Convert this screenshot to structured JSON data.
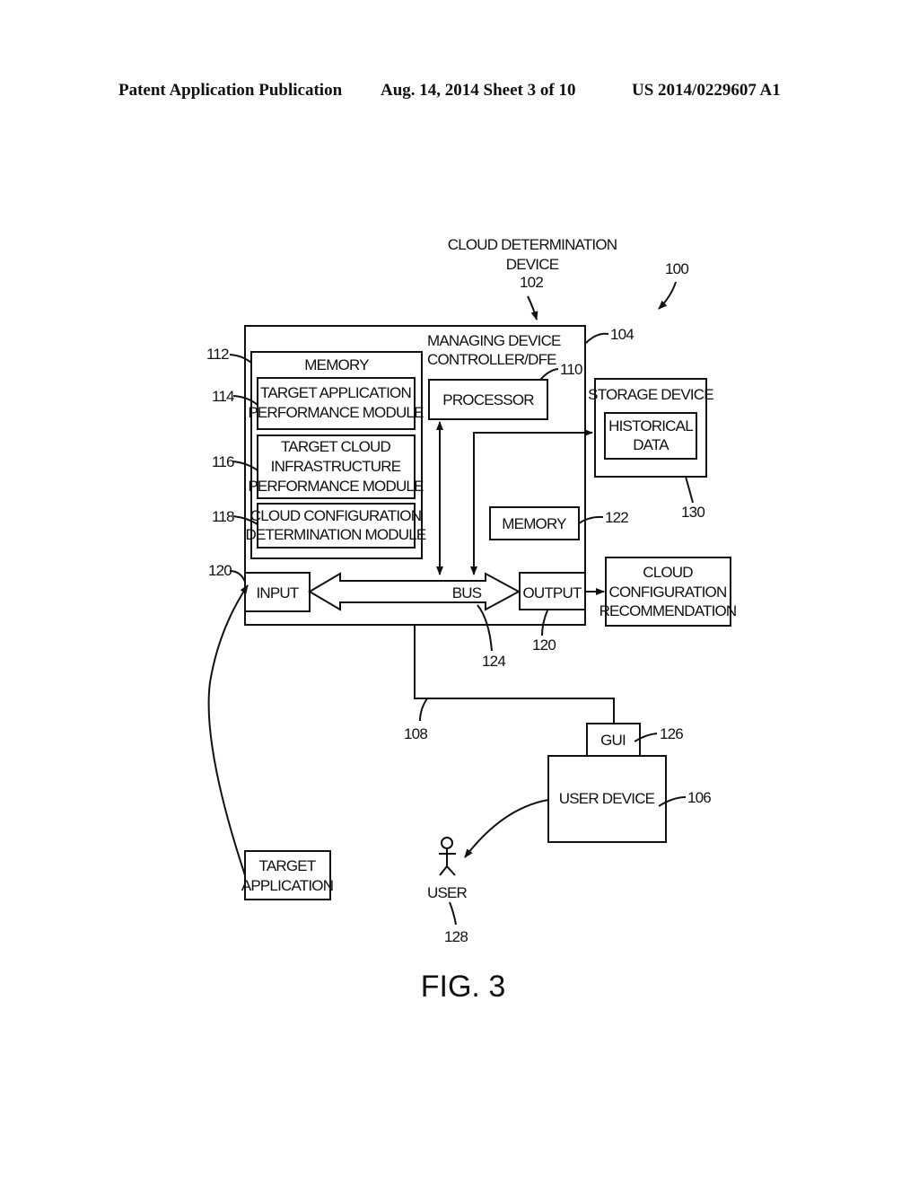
{
  "header": {
    "publication": "Patent Application Publication",
    "date_sheet": "Aug. 14, 2014  Sheet 3 of 10",
    "number": "US 2014/0229607 A1"
  },
  "diagram": {
    "title_line1": "CLOUD DETERMINATION",
    "title_line2": "DEVICE",
    "ref_102": "102",
    "ref_100": "100",
    "ref_104": "104",
    "managing_line1": "MANAGING DEVICE",
    "managing_line2": "CONTROLLER/DFE",
    "memory_112": {
      "ref": "112",
      "label": "MEMORY"
    },
    "module_114": {
      "ref": "114",
      "line1": "TARGET APPLICATION",
      "line2": "PERFORMANCE MODULE"
    },
    "module_116": {
      "ref": "116",
      "line1": "TARGET CLOUD",
      "line2": "INFRASTRUCTURE",
      "line3": "PERFORMANCE MODULE"
    },
    "module_118": {
      "ref": "118",
      "line1": "CLOUD CONFIGURATION",
      "line2": "DETERMINATION MODULE"
    },
    "processor": {
      "ref": "110",
      "label": "PROCESSOR"
    },
    "storage": {
      "ref": "130",
      "label": "STORAGE DEVICE",
      "inner_line1": "HISTORICAL",
      "inner_line2": "DATA"
    },
    "memory_122": {
      "ref": "122",
      "label": "MEMORY"
    },
    "input": {
      "ref": "120",
      "label": "INPUT"
    },
    "bus": {
      "ref": "124",
      "label": "BUS"
    },
    "output": {
      "ref": "120",
      "label": "OUTPUT"
    },
    "recommendation": {
      "line1": "CLOUD",
      "line2": "CONFIGURATION",
      "line3": "RECOMMENDATION"
    },
    "network_ref": "108",
    "gui": {
      "ref": "126",
      "label": "GUI"
    },
    "user_device": {
      "ref": "106",
      "label": "USER DEVICE"
    },
    "user": {
      "ref": "128",
      "label": "USER"
    },
    "target_app": {
      "line1": "TARGET",
      "line2": "APPLICATION"
    },
    "figure_label": "FIG. 3"
  }
}
